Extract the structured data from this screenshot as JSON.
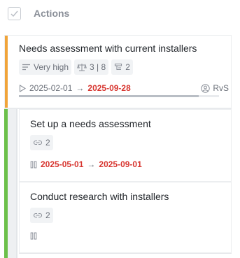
{
  "header": {
    "title": "Actions"
  },
  "main_card": {
    "title": "Needs assessment with current installers",
    "priority": "Very high",
    "effort": "3 | 8",
    "children_count": "2",
    "start_date": "2025-02-01",
    "end_date": "2025-09-28",
    "owner": "RvS",
    "progress": 0.9,
    "stripe_color": "#f0a43a"
  },
  "sub_cards": [
    {
      "title": "Set up a needs assessment",
      "links": "2",
      "start_date": "2025-05-01",
      "end_date": "2025-09-01"
    },
    {
      "title": "Conduct research with installers",
      "links": "2"
    }
  ]
}
